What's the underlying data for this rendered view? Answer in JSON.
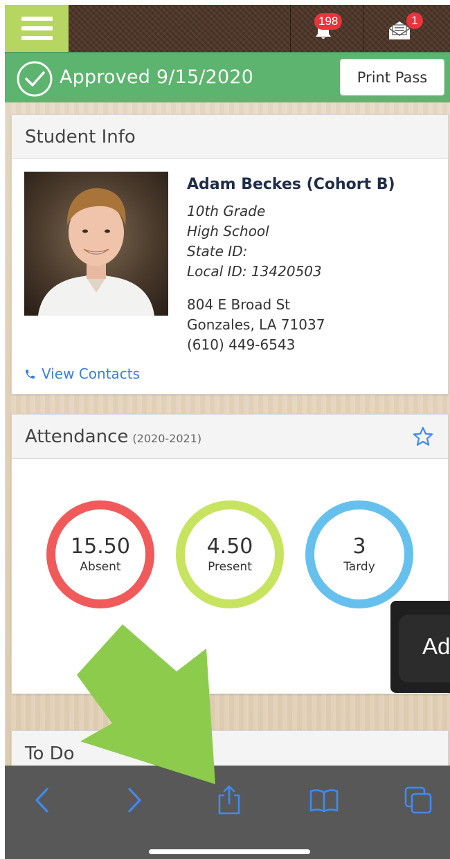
{
  "topbar": {
    "notifications_count": "198",
    "messages_count": "1"
  },
  "status": {
    "approved_text": "Approved 9/15/2020",
    "print_pass_label": "Print Pass"
  },
  "student_info": {
    "title": "Student Info",
    "name": "Adam Beckes (Cohort B)",
    "grade": "10th Grade",
    "school": "High School",
    "state_id": "State ID:",
    "local_id": "Local ID: 13420503",
    "address_line1": "804 E Broad St",
    "address_line2": "Gonzales, LA 71037",
    "phone": "(610) 449-6543",
    "view_contacts_label": "View Contacts"
  },
  "attendance": {
    "title": "Attendance",
    "year": "(2020-2021)",
    "stats": [
      {
        "value": "15.50",
        "label": "Absent",
        "color": "#f05a5b"
      },
      {
        "value": "4.50",
        "label": "Present",
        "color": "#c7e35f"
      },
      {
        "value": "3",
        "label": "Tardy",
        "color": "#66c0ee"
      }
    ]
  },
  "todo": {
    "title": "To Do"
  },
  "popup": {
    "text": "Ad"
  },
  "colors": {
    "accent_green": "#5db46e",
    "menu_green": "#b6d561",
    "link_blue": "#3b7fd6",
    "safari_blue": "#3d8bf2",
    "arrow_green": "#8dcb4c"
  },
  "icons": {
    "menu": "hamburger-icon",
    "notifications": "bell-icon",
    "messages": "envelope-icon",
    "approved": "check-circle-icon",
    "contacts": "phone-icon",
    "favorite": "star-icon",
    "back": "chevron-left-icon",
    "forward": "chevron-right-icon",
    "share": "share-icon",
    "bookmarks": "book-icon",
    "tabs": "tabs-icon"
  }
}
